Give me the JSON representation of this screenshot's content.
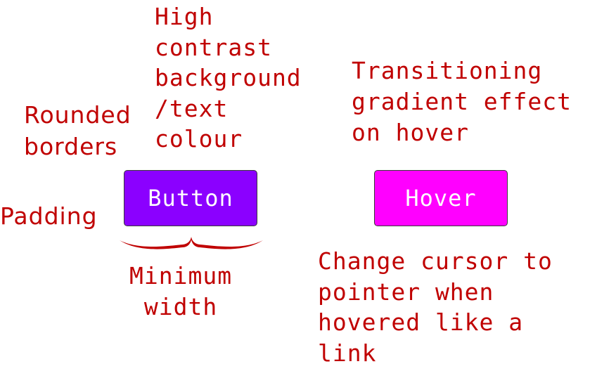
{
  "annotations": {
    "high_contrast": "High\ncontrast\nbackground\n/text\ncolour",
    "rounded_borders": "Rounded\nborders",
    "padding": "Padding",
    "transition": "Transitioning\ngradient effect\non hover",
    "minimum_width": "Minimum\nwidth",
    "cursor": "Change cursor to\npointer when\nhovered like a\nlink"
  },
  "buttons": {
    "default_label": "Button",
    "hover_label": "Hover"
  },
  "colors": {
    "annotation_text": "#c00000",
    "button_default_bg": "#8b00ff",
    "button_hover_bg": "#ff00ff",
    "button_text": "#ffffff",
    "button_border": "#3a3a3a"
  }
}
